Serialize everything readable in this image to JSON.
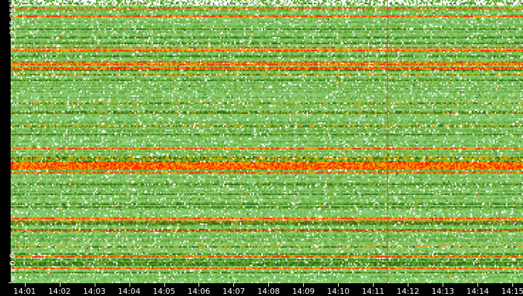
{
  "chart_data": {
    "type": "heatmap",
    "title": "",
    "ylabel_top": "x.x.255.255",
    "ylabel_bottom": "x.x.0.0",
    "x_ticks": [
      "14:01",
      "14:02",
      "14:03",
      "14:04",
      "14:05",
      "14:06",
      "14:07",
      "14:08",
      "14:09",
      "14:10",
      "14:11",
      "14:12",
      "14:13",
      "14:14",
      "14:15"
    ],
    "x_range_minutes": [
      0.6,
      15.3
    ],
    "marker_time_minutes": 11.4,
    "row_count": 199,
    "color_scale": [
      "#ffffff",
      "#8fcf7a",
      "#76b84e",
      "#5a9e2a",
      "#2c6b12",
      "#a8a800",
      "#ff9900",
      "#ff2a00"
    ],
    "hot_rows": [
      5,
      11,
      33,
      35,
      43,
      45,
      47,
      48,
      104,
      114,
      115,
      116,
      117,
      118,
      121,
      153,
      155,
      162,
      180,
      188
    ]
  }
}
